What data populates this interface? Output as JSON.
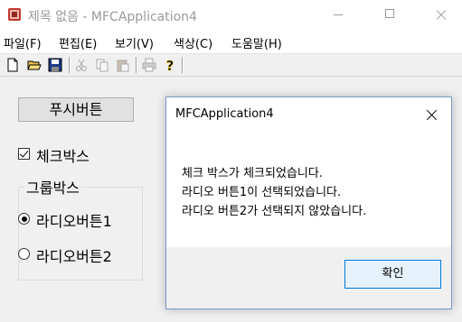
{
  "window": {
    "title": "제목 없음 - MFCApplication4",
    "icon": "mfc-app-icon",
    "controls": [
      "minimize-icon",
      "maximize-icon",
      "close-icon"
    ]
  },
  "menu": [
    {
      "label": "파일(F)"
    },
    {
      "label": "편집(E)"
    },
    {
      "label": "보기(V)"
    },
    {
      "label": "색상(C)"
    },
    {
      "label": "도움말(H)"
    }
  ],
  "toolbar": {
    "icons": [
      "new-file-icon",
      "open-folder-icon",
      "save-icon",
      "cut-icon",
      "copy-icon",
      "paste-icon",
      "print-icon",
      "help-icon"
    ]
  },
  "controls": {
    "push_button": "푸시버튼",
    "checkbox": {
      "label": "체크박스",
      "checked": true
    },
    "group_label": "그룹박스",
    "radios": [
      {
        "label": "라디오버튼1",
        "selected": true
      },
      {
        "label": "라디오버튼2",
        "selected": false
      }
    ]
  },
  "dialog": {
    "title": "MFCApplication4",
    "lines": [
      "체크 박스가 체크되었습니다.",
      "라디오 버튼1이 선택되었습니다.",
      "라디오 버튼2가 선택되지 않았습니다."
    ],
    "ok_label": "확인",
    "colors": {
      "ok_fill": "#e5f1fb",
      "ok_border": "#0078d7"
    }
  }
}
